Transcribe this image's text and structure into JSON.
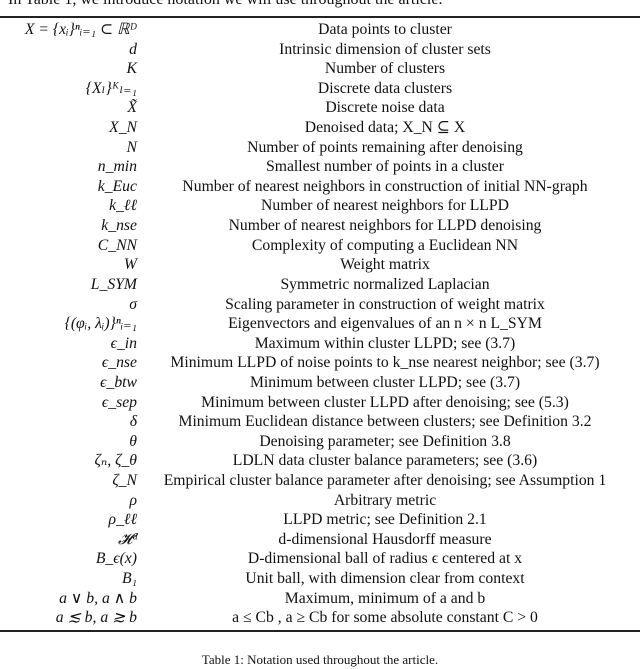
{
  "intro": "In Table 1, we introduce notation we will use throughout the article.",
  "rows": [
    {
      "symbol": "X = {xᵢ}ⁿᵢ₌₁ ⊂ ℝᴰ",
      "description": "Data points to cluster"
    },
    {
      "symbol": "d",
      "description": "Intrinsic dimension of cluster sets"
    },
    {
      "symbol": "K",
      "description": "Number of clusters"
    },
    {
      "symbol": "{Xₗ}ᴷₗ₌₁",
      "description": "Discrete data clusters"
    },
    {
      "symbol": "X̃",
      "description": "Discrete noise data"
    },
    {
      "symbol": "X_N",
      "description": "Denoised data; X_N ⊆ X"
    },
    {
      "symbol": "N",
      "description": "Number of points remaining after denoising"
    },
    {
      "symbol": "n_min",
      "description": "Smallest number of points in a cluster"
    },
    {
      "symbol": "k_Euc",
      "description": "Number of nearest neighbors in construction of initial NN-graph"
    },
    {
      "symbol": "k_ℓℓ",
      "description": "Number of nearest neighbors for LLPD"
    },
    {
      "symbol": "k_nse",
      "description": "Number of nearest neighbors for LLPD denoising"
    },
    {
      "symbol": "C_NN",
      "description": "Complexity of computing a Euclidean NN"
    },
    {
      "symbol": "W",
      "description": "Weight matrix"
    },
    {
      "symbol": "L_SYM",
      "description": "Symmetric normalized Laplacian"
    },
    {
      "symbol": "σ",
      "description": "Scaling parameter in construction of weight matrix"
    },
    {
      "symbol": "{(φᵢ, λᵢ)}ⁿᵢ₌₁",
      "description": "Eigenvectors and eigenvalues of an n × n L_SYM"
    },
    {
      "symbol": "ϵ_in",
      "description": "Maximum within cluster LLPD; see (3.7)"
    },
    {
      "symbol": "ϵ_nse",
      "description": "Minimum LLPD of noise points to k_nse nearest neighbor; see (3.7)"
    },
    {
      "symbol": "ϵ_btw",
      "description": "Minimum between cluster LLPD; see (3.7)"
    },
    {
      "symbol": "ϵ_sep",
      "description": "Minimum between cluster LLPD after denoising; see (5.3)"
    },
    {
      "symbol": "δ",
      "description": "Minimum Euclidean distance between clusters; see Definition 3.2"
    },
    {
      "symbol": "θ",
      "description": "Denoising parameter; see Definition 3.8"
    },
    {
      "symbol": "ζₙ, ζ_θ",
      "description": "LDLN data cluster balance parameters; see (3.6)"
    },
    {
      "symbol": "ζ_N",
      "description": "Empirical cluster balance parameter after denoising; see Assumption 1"
    },
    {
      "symbol": "ρ",
      "description": "Arbitrary metric"
    },
    {
      "symbol": "ρ_ℓℓ",
      "description": "LLPD metric; see Definition 2.1"
    },
    {
      "symbol": "𝓗ᵈ",
      "description": "d-dimensional Hausdorff measure"
    },
    {
      "symbol": "B_ϵ(x)",
      "description": "D-dimensional ball of radius ϵ centered at x"
    },
    {
      "symbol": "B₁",
      "description": "Unit ball, with dimension clear from context"
    },
    {
      "symbol": "a ∨ b, a ∧ b",
      "description": "Maximum, minimum of a and b"
    },
    {
      "symbol": "a ≲ b, a ≳ b",
      "description": "a ≤ Cb , a ≥ Cb for some absolute constant C > 0"
    }
  ],
  "caption": "Table 1: Notation used throughout the article."
}
